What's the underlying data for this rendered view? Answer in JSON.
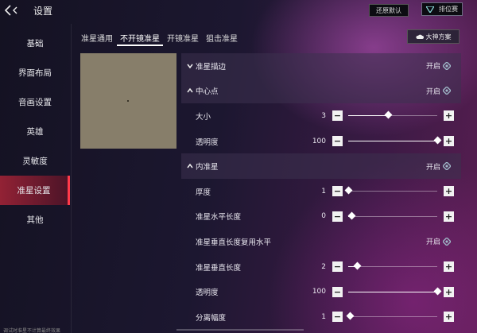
{
  "header": {
    "title": "设置",
    "reset_label": "还原默认",
    "rank_label": "排位赛"
  },
  "sidebar": {
    "items": [
      {
        "label": "基础"
      },
      {
        "label": "界面布局"
      },
      {
        "label": "音画设置"
      },
      {
        "label": "英雄"
      },
      {
        "label": "灵敏度"
      },
      {
        "label": "准星设置",
        "active": true
      },
      {
        "label": "其他"
      }
    ]
  },
  "tabs": [
    {
      "label": "准星通用"
    },
    {
      "label": "不开镜准星",
      "active": true
    },
    {
      "label": "开镜准星"
    },
    {
      "label": "狙击准星"
    }
  ],
  "plan_button": {
    "label": "大神方案"
  },
  "settings": {
    "outline": {
      "label": "准星描边",
      "state": "开启"
    },
    "center_dot": {
      "label": "中心点",
      "state": "开启"
    },
    "center_size": {
      "label": "大小",
      "value": "3",
      "level": 0.45
    },
    "center_opacity": {
      "label": "透明度",
      "value": "100",
      "level": 1.0
    },
    "inner": {
      "label": "内准星",
      "state": "开启"
    },
    "thickness": {
      "label": "厚度",
      "value": "1",
      "level": 0.0
    },
    "h_length": {
      "label": "准星水平长度",
      "value": "0",
      "level": 0.04
    },
    "v_reuse": {
      "label": "准星垂直长度复用水平",
      "state": "开启"
    },
    "v_length": {
      "label": "准星垂直长度",
      "value": "2",
      "level": 0.1
    },
    "inner_opacity": {
      "label": "透明度",
      "value": "100",
      "level": 1.0
    },
    "separation": {
      "label": "分离幅度",
      "value": "1",
      "level": 0.02
    }
  },
  "colors": {
    "accent": "#ff3a4a",
    "preview_bg": "#877e6a"
  },
  "footer_note": "调试时准星不计算最终效果"
}
